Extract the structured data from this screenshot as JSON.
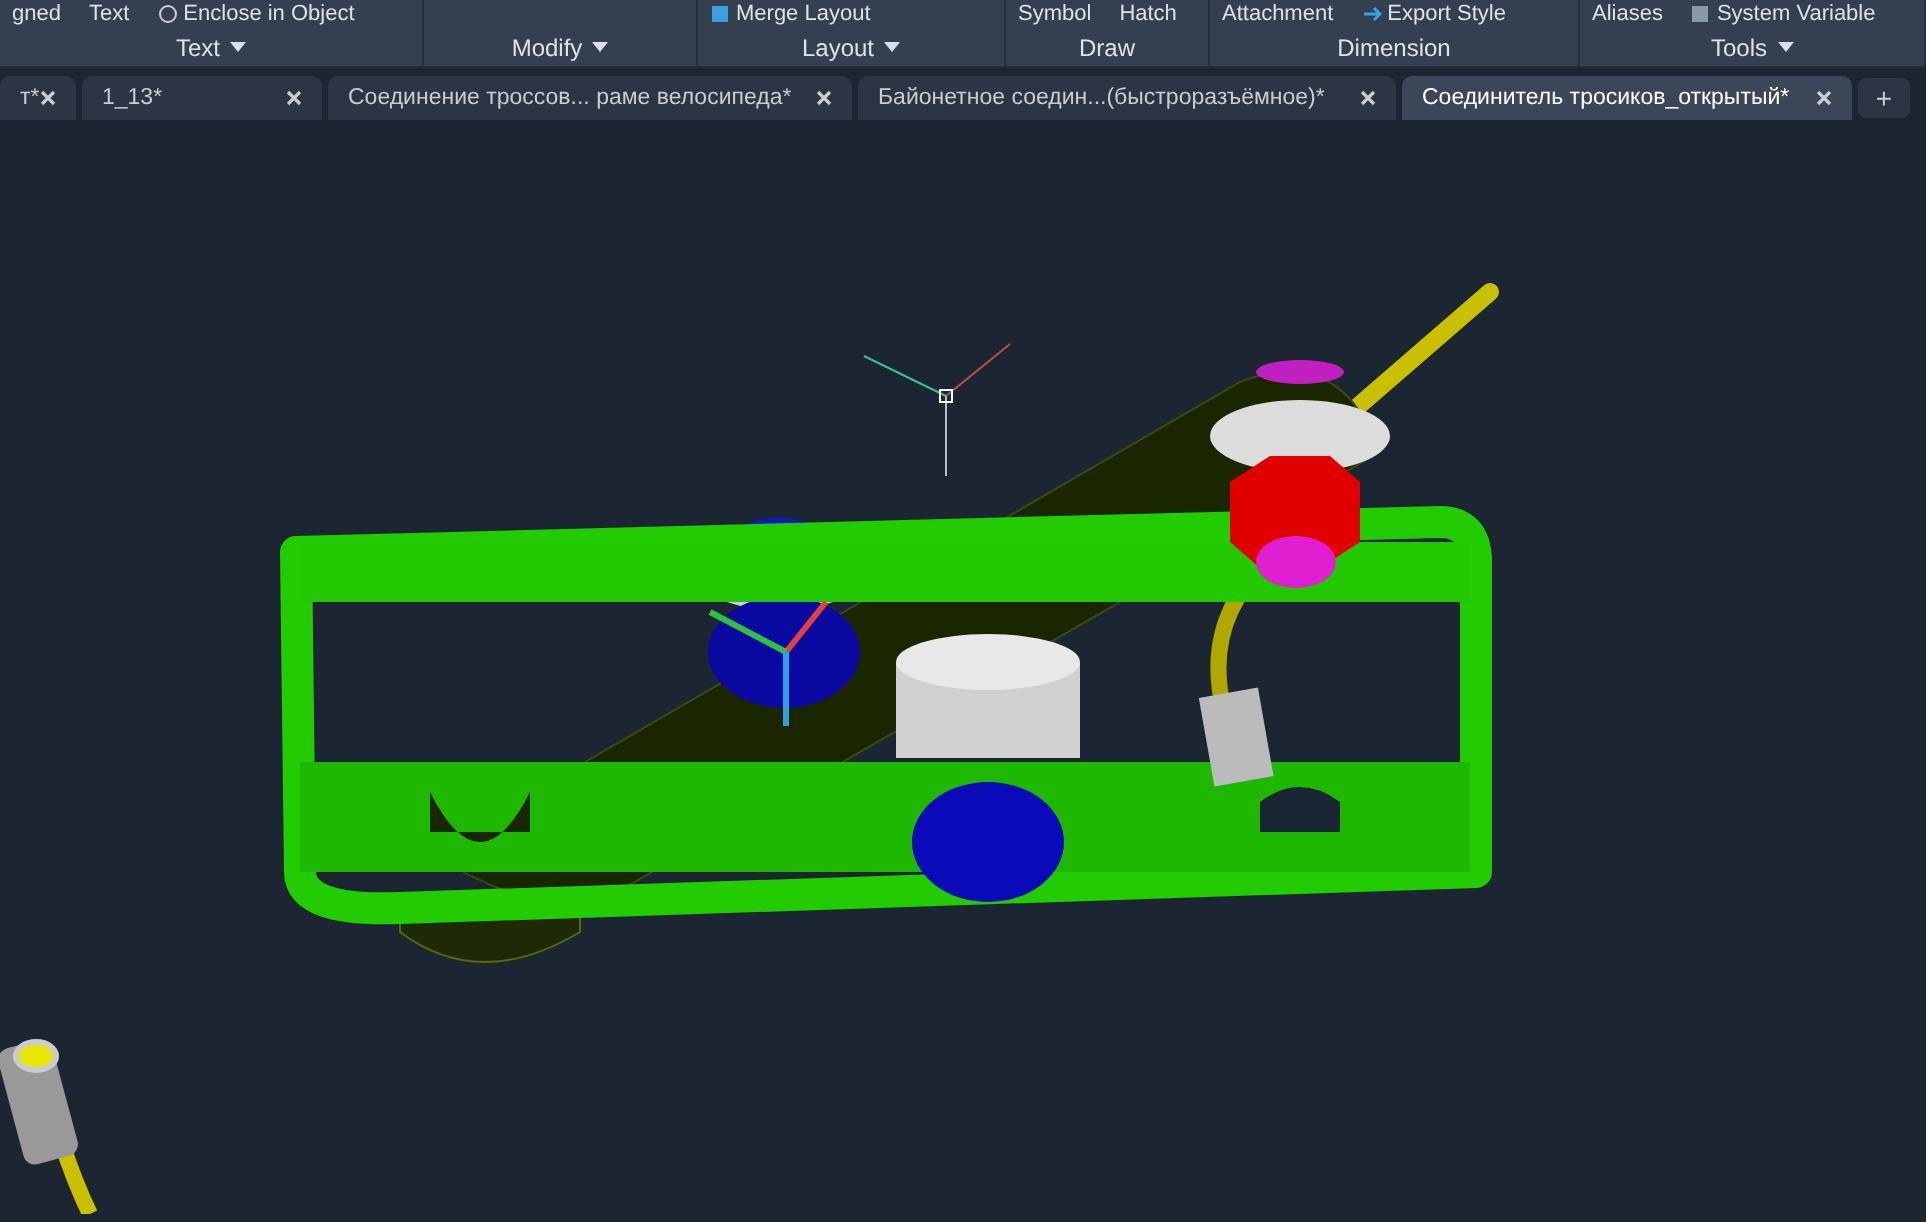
{
  "ribbon": {
    "panels": [
      {
        "label": "Text",
        "dropdown": true,
        "tools": [
          "gned",
          "Text",
          "Enclose in Object"
        ]
      },
      {
        "label": "Modify",
        "dropdown": true
      },
      {
        "label": "Layout",
        "dropdown": true,
        "tools": [
          "Merge Layout"
        ]
      },
      {
        "label": "Draw",
        "dropdown": false,
        "tools": [
          "Symbol",
          "Hatch"
        ]
      },
      {
        "label": "Dimension",
        "dropdown": false,
        "tools": [
          "Attachment",
          "Export Style"
        ]
      },
      {
        "label": "Tools",
        "dropdown": true,
        "tools": [
          "Aliases",
          "System Variable"
        ]
      }
    ]
  },
  "tabs": [
    {
      "label": "т*",
      "selected": false
    },
    {
      "label": "1_13*",
      "selected": false
    },
    {
      "label": "Соединение троссов... раме велосипеда*",
      "selected": false
    },
    {
      "label": "Байонетное соедин...(быстроразъёмное)*",
      "selected": false
    },
    {
      "label": "Соединитель тросиков_открытый*",
      "selected": true
    }
  ],
  "new_tab": "+"
}
